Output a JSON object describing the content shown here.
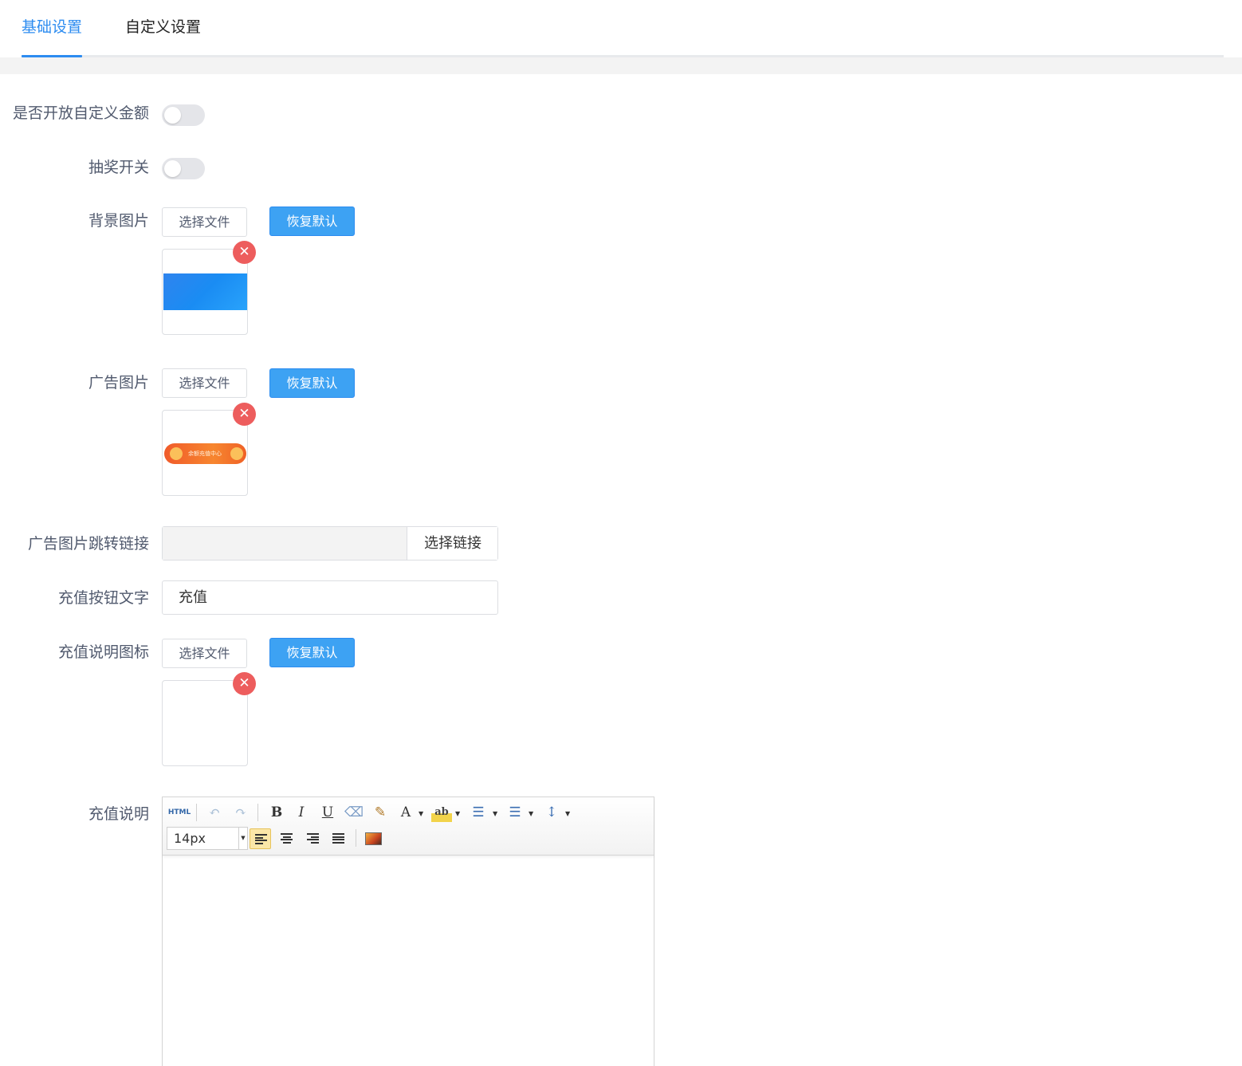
{
  "tabs": [
    {
      "label": "基础设置",
      "active": true
    },
    {
      "label": "自定义设置",
      "active": false
    }
  ],
  "accent_color": "#2d8cf0",
  "danger_color": "#ed5d5d",
  "form": {
    "custom_amount": {
      "label": "是否开放自定义金额",
      "on": false
    },
    "lottery": {
      "label": "抽奖开关",
      "on": false
    },
    "bg_image": {
      "label": "背景图片",
      "choose_label": "选择文件",
      "reset_label": "恢复默认",
      "delete_icon": "close-icon"
    },
    "ad_image": {
      "label": "广告图片",
      "choose_label": "选择文件",
      "reset_label": "恢复默认",
      "banner_text": "余额充值中心",
      "delete_icon": "close-icon"
    },
    "ad_link": {
      "label": "广告图片跳转链接",
      "value": "",
      "button_label": "选择链接"
    },
    "recharge_btn_text": {
      "label": "充值按钮文字",
      "value": "充值"
    },
    "recharge_icon": {
      "label": "充值说明图标",
      "choose_label": "选择文件",
      "reset_label": "恢复默认",
      "delete_icon": "close-icon"
    },
    "recharge_desc": {
      "label": "充值说明",
      "font_size": "14px",
      "toolbar": {
        "html": "HTML",
        "bold": "B",
        "italic": "I",
        "underline": "U",
        "font_color": "A",
        "font_color_icon": "font-color-icon",
        "highlight": "ab",
        "highlight_icon": "highlight-icon",
        "icons": [
          "undo-icon",
          "redo-icon",
          "eraser-icon",
          "format-brush-icon",
          "ordered-list-icon",
          "unordered-list-icon",
          "line-height-icon",
          "align-left-icon",
          "align-center-icon",
          "align-right-icon",
          "align-justify-icon",
          "image-icon"
        ]
      },
      "content": ""
    }
  }
}
